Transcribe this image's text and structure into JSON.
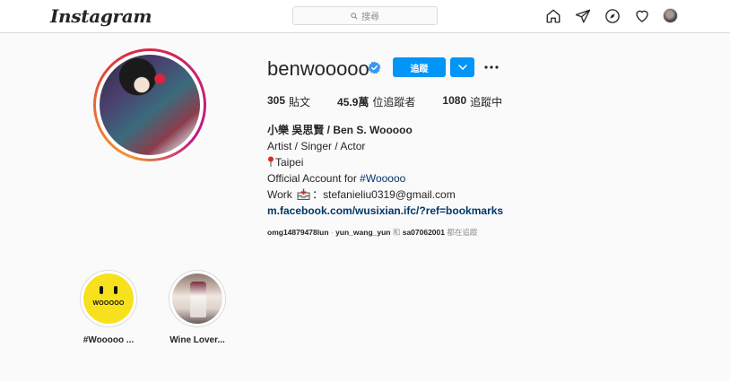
{
  "nav": {
    "logo": "Instagram",
    "search_placeholder": "搜尋",
    "icons": [
      "home-icon",
      "direct-icon",
      "explore-icon",
      "activity-icon"
    ]
  },
  "profile": {
    "username": "benwooooo",
    "verified": true,
    "follow_label": "追蹤",
    "stats": {
      "posts_count": "305",
      "posts_label": "貼文",
      "followers_count": "45.9萬",
      "followers_label": "位追蹤者",
      "following_count": "1080",
      "following_label": "追蹤中"
    },
    "bio": {
      "full_name": "小樂 吳思賢 / Ben S. Wooooo",
      "line1": "Artist / Singer / Actor",
      "location": "Taipei",
      "official_prefix": "Official Account for ",
      "official_hashtag": "#Wooooo",
      "work_prefix": "Work",
      "work_email": "：stefanieliu0319@gmail.com",
      "link": "m.facebook.com/wusixian.ifc/?ref=bookmarks"
    },
    "followed_by": {
      "user1": "omg14879478lun",
      "separator": " · ",
      "user2": "yun_wang_yun",
      "and": " 和 ",
      "user3": "sa07062001",
      "suffix": " 都在追蹤"
    }
  },
  "highlights": [
    {
      "label": "#Wooooo ...",
      "badge_text": "WOOOOO"
    },
    {
      "label": "Wine Lover..."
    }
  ],
  "colors": {
    "primary_blue": "#0095f6",
    "link_blue": "#00376b",
    "text": "#262626",
    "muted": "#8e8e8e",
    "border": "#dbdbdb",
    "background": "#fafafa"
  }
}
